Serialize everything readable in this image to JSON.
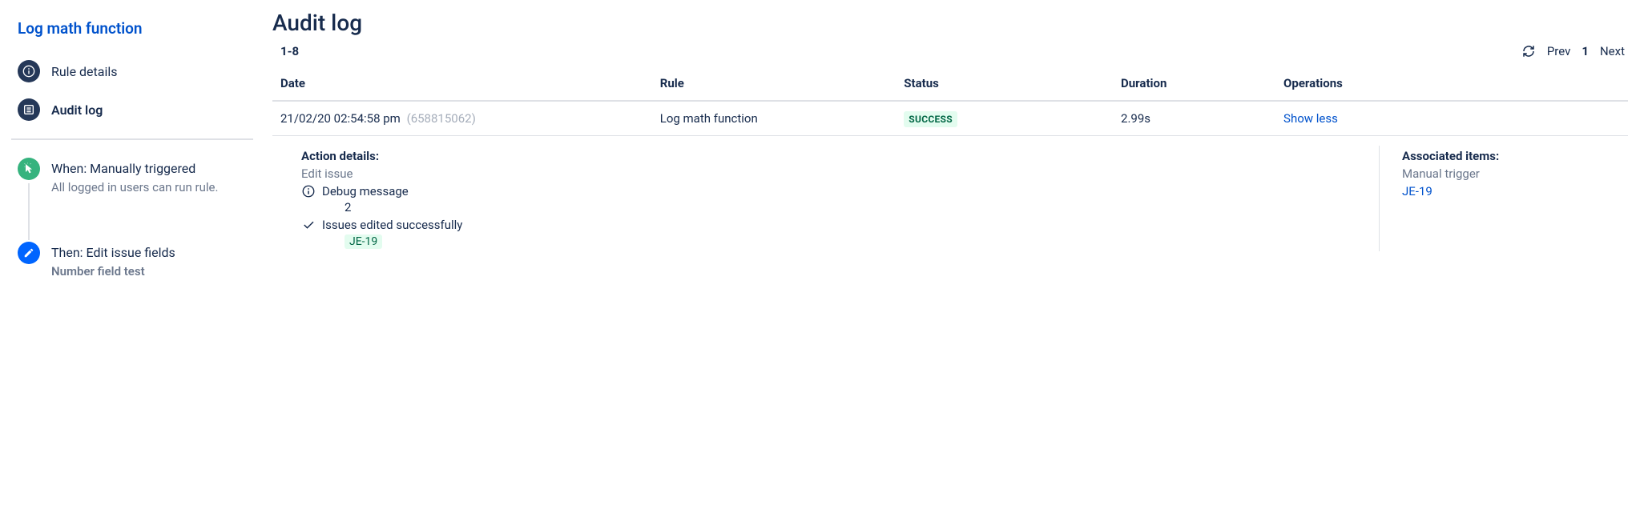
{
  "sidebar": {
    "title": "Log math function",
    "items": [
      {
        "label": "Rule details"
      },
      {
        "label": "Audit log"
      }
    ],
    "steps": [
      {
        "title": "When: Manually triggered",
        "sub": "All logged in users can run rule."
      },
      {
        "title": "Then: Edit issue fields",
        "sub": "Number field test"
      }
    ]
  },
  "main": {
    "title": "Audit log",
    "range": "1-8",
    "pager": {
      "prev": "Prev",
      "page": "1",
      "next": "Next"
    },
    "columns": {
      "date": "Date",
      "rule": "Rule",
      "status": "Status",
      "duration": "Duration",
      "operations": "Operations"
    },
    "row": {
      "date": "21/02/20 02:54:58 pm",
      "id": "(658815062)",
      "rule": "Log math function",
      "status": "SUCCESS",
      "duration": "2.99s",
      "operation": "Show less"
    },
    "details": {
      "action_label": "Action details:",
      "action_name": "Edit issue",
      "debug_label": "Debug message",
      "debug_value": "2",
      "success_label": "Issues edited successfully",
      "issue": "JE-19",
      "associated_label": "Associated items:",
      "associated_trigger": "Manual trigger",
      "associated_issue": "JE-19"
    }
  }
}
